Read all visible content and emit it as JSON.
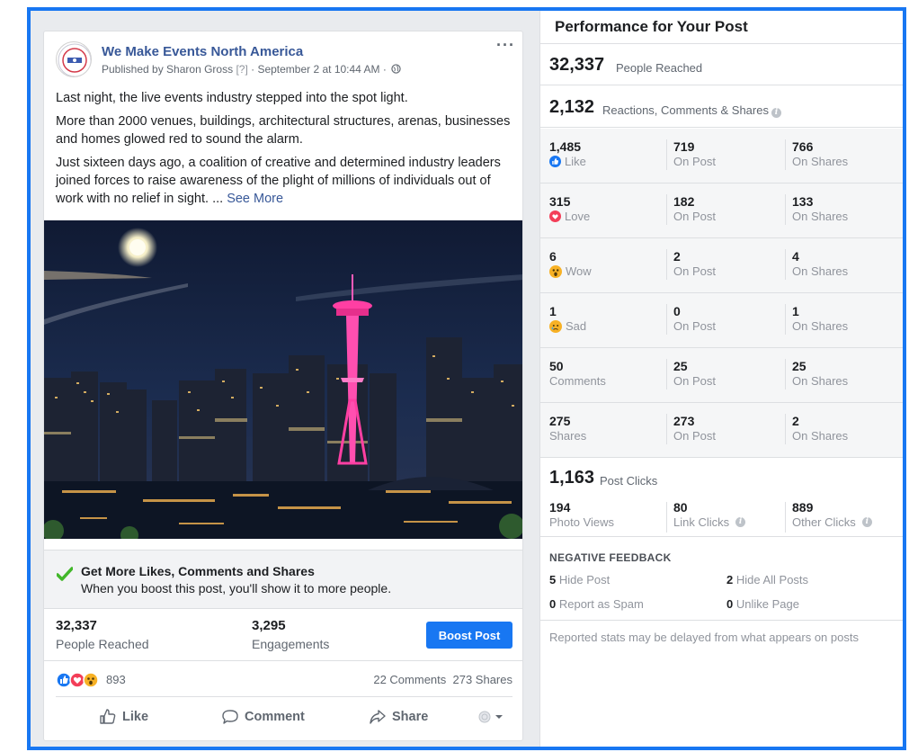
{
  "post": {
    "page_name": "We Make Events North America",
    "published_by": "Published by Sharon Gross",
    "help_marker": "[?]",
    "date": " · September 2 at 10:44 AM · ",
    "paragraphs": [
      "Last night, the live events industry stepped into the spot light.",
      "More than 2000 venues, buildings, architectural structures, arenas, businesses and homes glowed red to sound the alarm.",
      "Just sixteen days ago, a coalition of creative and determined industry leaders joined forces to raise awareness of the plight of millions of individuals out of work with no relief in sight. ... "
    ],
    "see_more": "See More",
    "more_options": "···",
    "boost_prompt_title": "Get More Likes, Comments and Shares",
    "boost_prompt_sub": "When you boost this post, you'll show it to more people.",
    "people_reached_value": "32,337",
    "people_reached_label": "People Reached",
    "engagements_value": "3,295",
    "engagements_label": "Engagements",
    "boost_button": "Boost Post",
    "reaction_count": "893",
    "comments": "22 Comments",
    "shares": "273 Shares",
    "actions": {
      "like": "Like",
      "comment": "Comment",
      "share": "Share"
    }
  },
  "panel": {
    "title": "Performance for Your Post",
    "reached_value": "32,337",
    "reached_label": "People Reached",
    "rcs_value": "2,132",
    "rcs_label": "Reactions, Comments & Shares",
    "rows": [
      {
        "total": "1,485",
        "label": "Like",
        "icon": "like-icon",
        "on_post": "719",
        "on_shares": "766"
      },
      {
        "total": "315",
        "label": "Love",
        "icon": "love-icon",
        "on_post": "182",
        "on_shares": "133"
      },
      {
        "total": "6",
        "label": "Wow",
        "icon": "wow-icon",
        "on_post": "2",
        "on_shares": "4"
      },
      {
        "total": "1",
        "label": "Sad",
        "icon": "sad-icon",
        "on_post": "0",
        "on_shares": "1"
      },
      {
        "total": "50",
        "label": "Comments",
        "icon": "",
        "on_post": "25",
        "on_shares": "25"
      },
      {
        "total": "275",
        "label": "Shares",
        "icon": "",
        "on_post": "273",
        "on_shares": "2"
      }
    ],
    "on_post_label": "On Post",
    "on_shares_label": "On Shares",
    "post_clicks_value": "1,163",
    "post_clicks_label": "Post Clicks",
    "photo_views_value": "194",
    "photo_views_label": "Photo Views",
    "link_clicks_value": "80",
    "link_clicks_label": "Link Clicks",
    "other_clicks_value": "889",
    "other_clicks_label": "Other Clicks",
    "negative_title": "NEGATIVE FEEDBACK",
    "hide_post_value": "5",
    "hide_post_label": " Hide Post",
    "hide_all_value": "2",
    "hide_all_label": " Hide All Posts",
    "spam_value": "0",
    "spam_label": " Report as Spam",
    "unlike_value": "0",
    "unlike_label": " Unlike Page",
    "footnote": "Reported stats may be delayed from what appears on posts"
  },
  "colors": {
    "frame": "#1877f2",
    "link": "#385898",
    "boost": "#1877f2",
    "love": "#f33e58",
    "wow": "#f7b125"
  }
}
